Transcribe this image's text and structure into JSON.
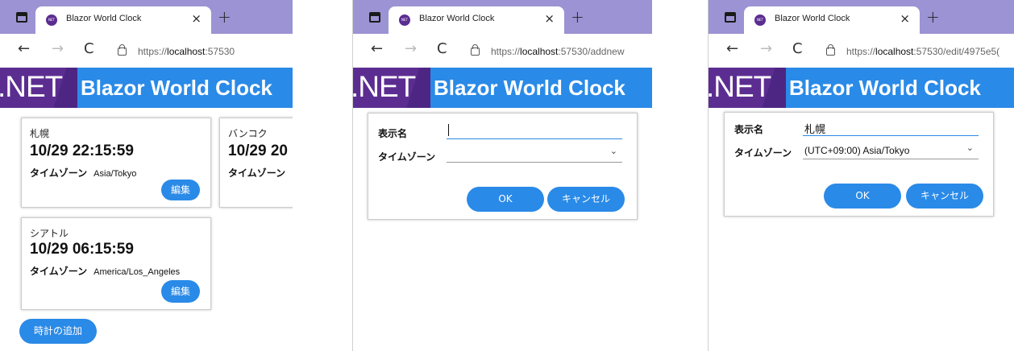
{
  "browser": {
    "tab_title": "Blazor World Clock",
    "close_glyph": "×",
    "newtab_glyph": "+",
    "back_glyph": "←",
    "forward_glyph": "→",
    "reload_glyph": "C"
  },
  "app": {
    "net_logo": ".NET",
    "title": "Blazor World Clock"
  },
  "window1": {
    "url_scheme": "https://",
    "url_host": "localhost",
    "url_rest": ":57530",
    "cards": [
      {
        "city": "札幌",
        "time": "10/29 22:15:59",
        "tz_label": "タイムゾーン",
        "tz_value": "Asia/Tokyo",
        "edit": "編集"
      },
      {
        "city": "バンコク",
        "time": "10/29 20",
        "tz_label": "タイムゾーン",
        "tz_value": ""
      },
      {
        "city": "シアトル",
        "time": "10/29 06:15:59",
        "tz_label": "タイムゾーン",
        "tz_value": "America/Los_Angeles",
        "edit": "編集"
      }
    ],
    "add_button": "時計の追加"
  },
  "window2": {
    "url_scheme": "https://",
    "url_host": "localhost",
    "url_rest": ":57530/addnew",
    "name_label": "表示名",
    "name_value": "",
    "tz_label": "タイムゾーン",
    "tz_value": "",
    "ok": "OK",
    "cancel": "キャンセル"
  },
  "window3": {
    "url_scheme": "https://",
    "url_host": "localhost",
    "url_rest": ":57530/edit/4975e5(",
    "name_label": "表示名",
    "name_value": "札幌",
    "tz_label": "タイムゾーン",
    "tz_value": "(UTC+09:00) Asia/Tokyo",
    "ok": "OK",
    "cancel": "キャンセル"
  },
  "icons": {
    "chevron_down": "⌄"
  },
  "colors": {
    "tabbar": "#9b93d3",
    "accent": "#2a8ae7",
    "net_purple": "#5c2d91"
  }
}
